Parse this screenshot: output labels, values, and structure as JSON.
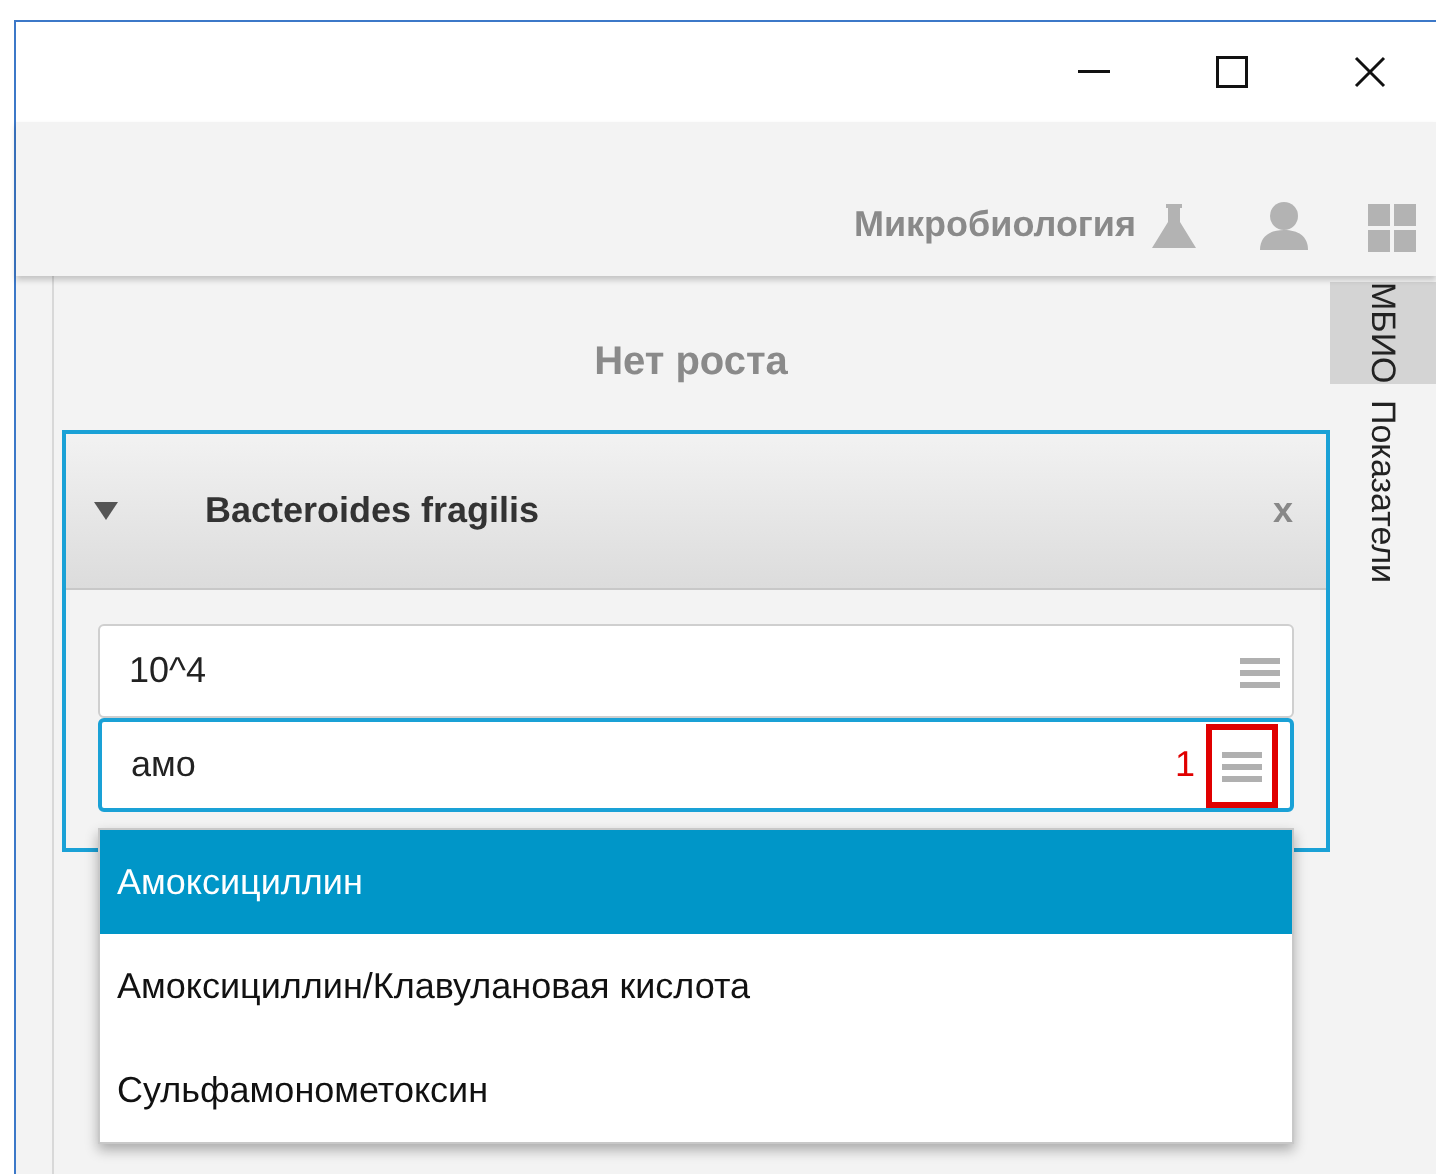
{
  "toolbar": {
    "module": "Микробиология"
  },
  "status": "Нет роста",
  "side_tabs": [
    {
      "label": "МБИО",
      "selected": true
    },
    {
      "label": "Показатели",
      "selected": false
    }
  ],
  "card": {
    "title": "Bacteroides fragilis",
    "expanded": true,
    "close": "x",
    "fields": [
      {
        "value": "10^4",
        "focused": false
      },
      {
        "value": "амо",
        "focused": true,
        "callout": "1"
      }
    ],
    "suggestions": [
      {
        "label": "Амоксициллин",
        "selected": true
      },
      {
        "label": "Амоксициллин/Клавулановая кислота",
        "selected": false
      },
      {
        "label": "Сульфамонометоксин",
        "selected": false
      }
    ]
  }
}
